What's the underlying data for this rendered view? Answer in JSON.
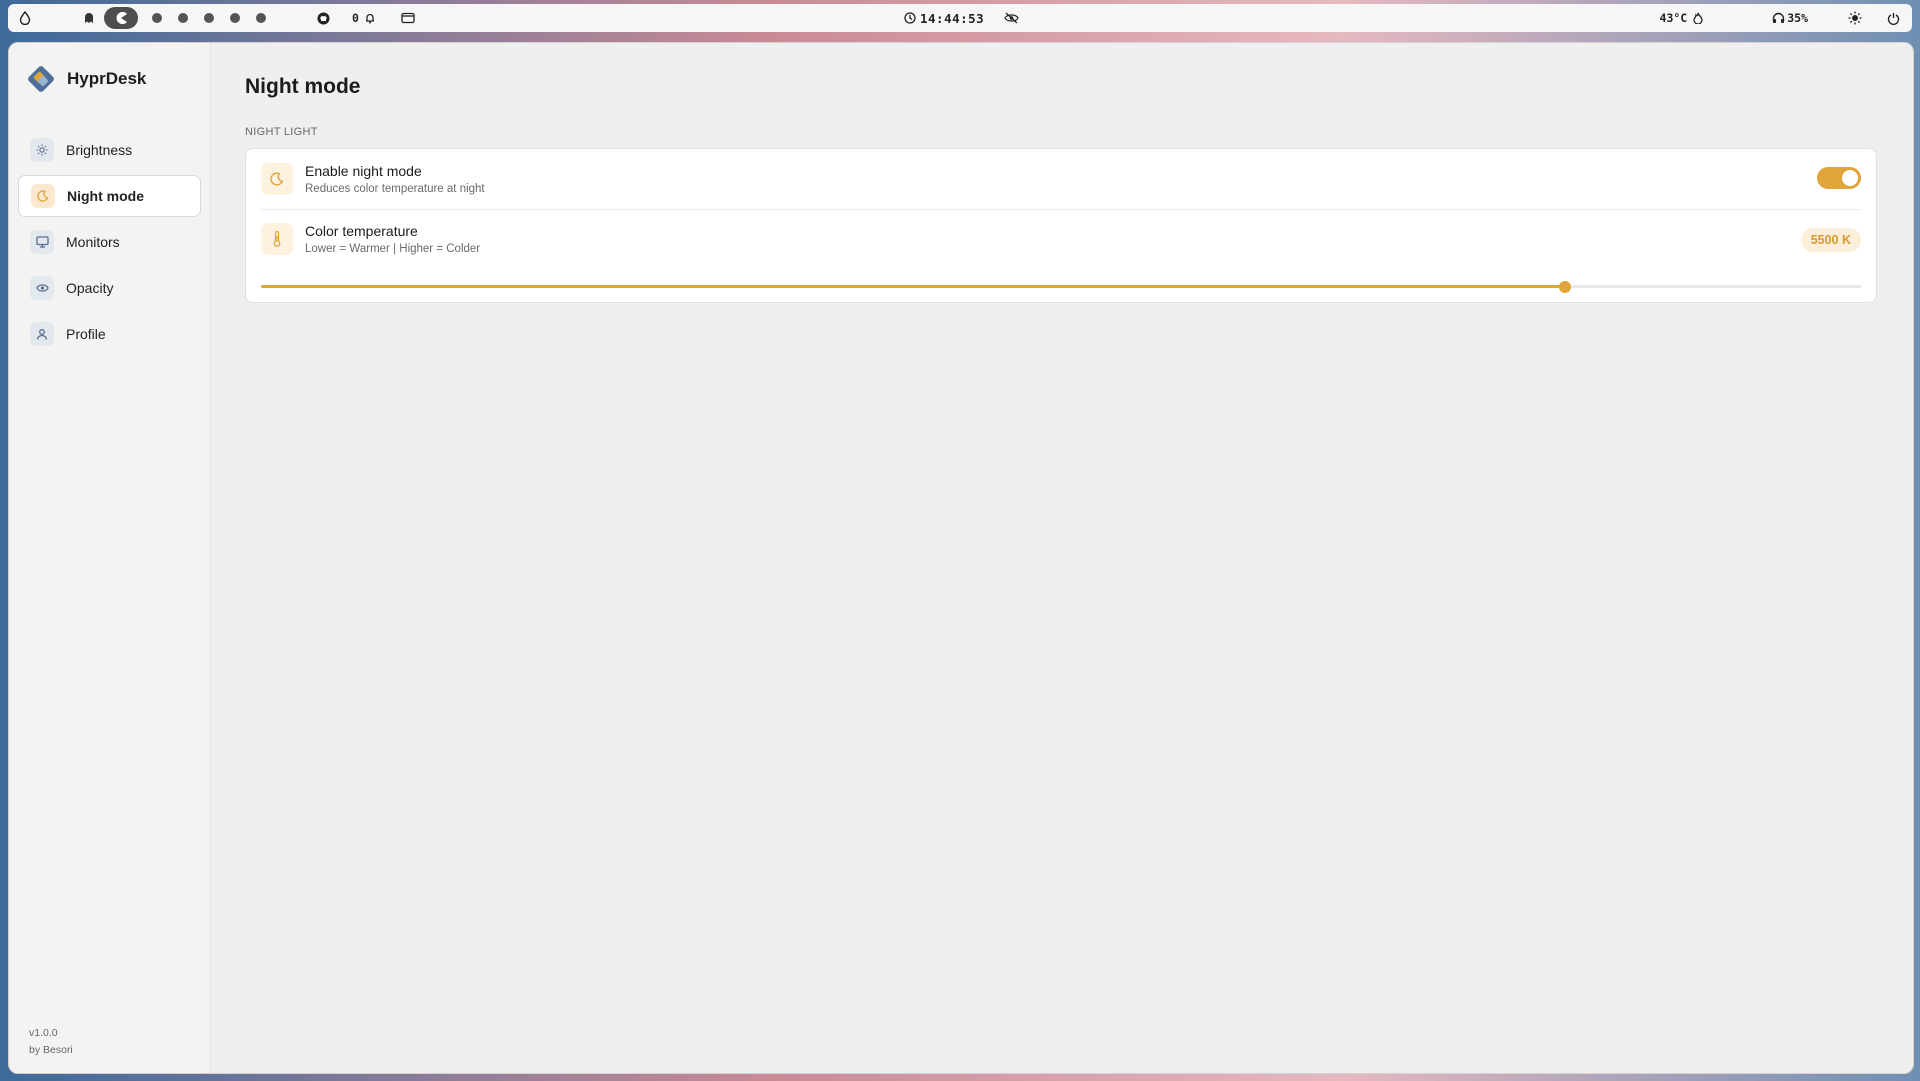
{
  "topbar": {
    "clock": "14:44:53",
    "notifications_count": "0",
    "temperature": "43°C",
    "volume": "35%",
    "workspaces_count": 6
  },
  "app": {
    "name": "HyprDesk",
    "version": "v1.0.0",
    "author": "by Besori"
  },
  "sidebar": {
    "items": [
      {
        "label": "Brightness",
        "icon": "sun-icon",
        "active": false
      },
      {
        "label": "Night mode",
        "icon": "moon-icon",
        "active": true
      },
      {
        "label": "Monitors",
        "icon": "monitor-icon",
        "active": false
      },
      {
        "label": "Opacity",
        "icon": "eye-icon",
        "active": false
      },
      {
        "label": "Profile",
        "icon": "user-icon",
        "active": false
      }
    ]
  },
  "main": {
    "title": "Night mode",
    "section": "NIGHT LIGHT",
    "night_mode": {
      "title": "Enable night mode",
      "subtitle": "Reduces color temperature at night",
      "enabled": true
    },
    "color_temperature": {
      "title": "Color temperature",
      "subtitle": "Lower = Warmer | Higher = Colder",
      "value_label": "5500 K",
      "slider_fraction": 0.815
    }
  },
  "colors": {
    "accent": "#e0a43a",
    "accent_soft": "#fcefd9"
  }
}
